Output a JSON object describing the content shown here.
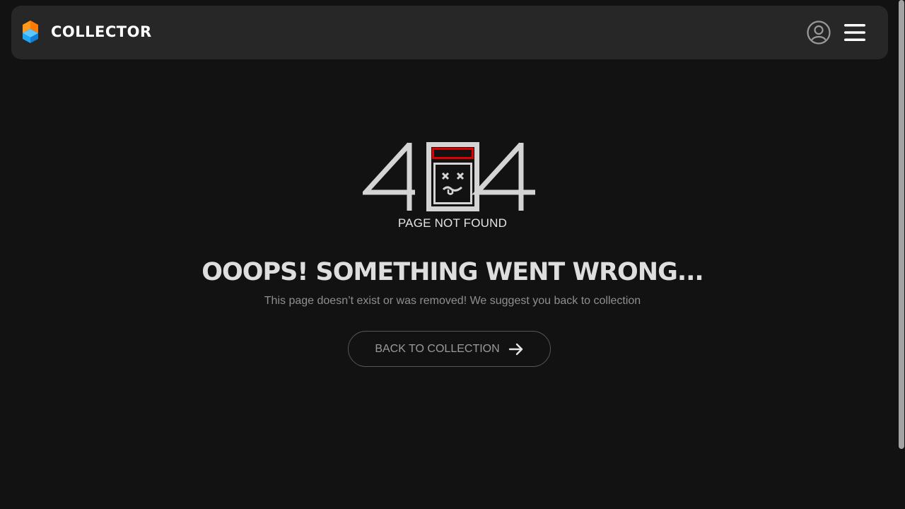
{
  "header": {
    "brand": "COLLECTOR",
    "logo_icon": "collector-cube-logo",
    "user_icon": "user-circle-icon",
    "menu_icon": "hamburger-menu-icon"
  },
  "error": {
    "code_graphic": "404",
    "label": "PAGE NOT FOUND",
    "headline": "OOOPS! SOMETHING WENT WRONG...",
    "message": "This page doesn’t exist or was removed! We suggest you back to collection",
    "button_label": "BACK TO COLLECTION",
    "button_icon": "arrow-right-icon"
  },
  "colors": {
    "background": "#121212",
    "header_bg": "#272727",
    "logo_orange": "#ff7a00",
    "logo_blue": "#1fa8f5",
    "error_accent": "#e00000",
    "text_light": "#dedede",
    "text_muted": "#8f8f8f"
  }
}
